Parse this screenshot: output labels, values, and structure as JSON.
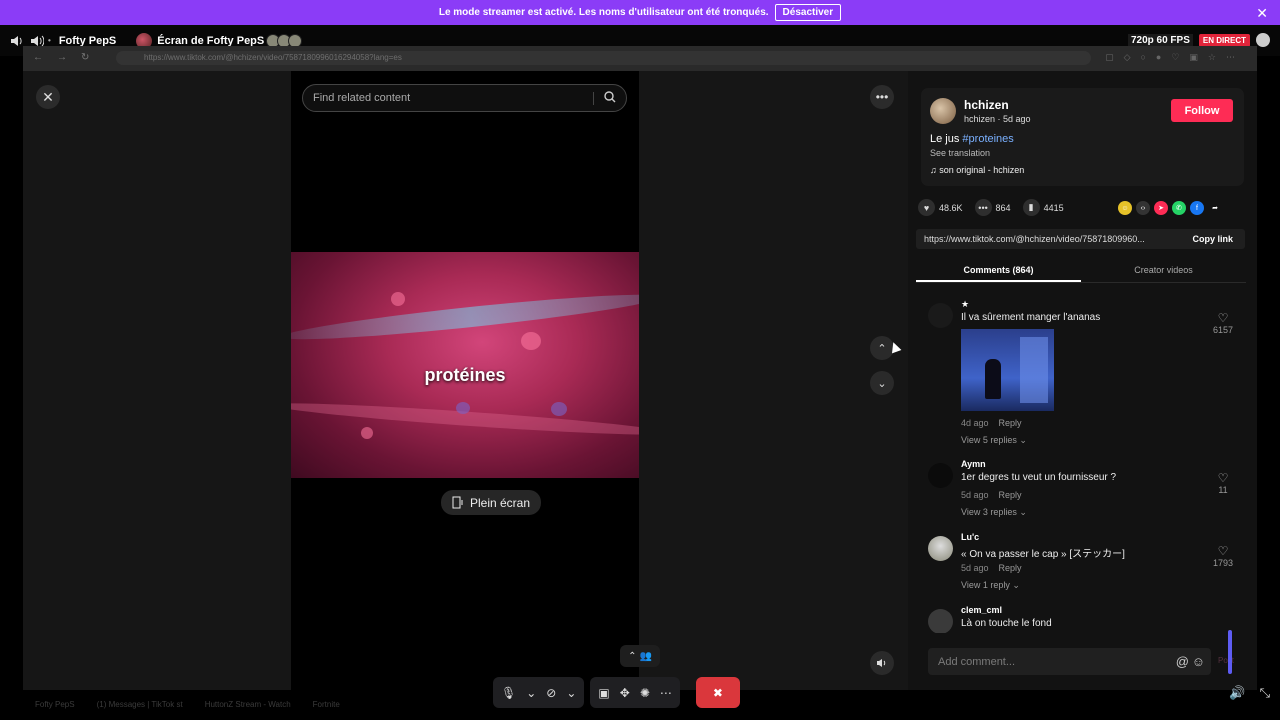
{
  "banner": {
    "text": "Le mode streamer est activé. Les noms d'utilisateur ont été tronqués.",
    "button": "Désactiver",
    "close": "✕"
  },
  "stream_header": {
    "user": "Fofty PepS",
    "screen_title": "Écran de Fofty PepS",
    "quality": "720p 60 FPS",
    "live": "EN DIRECT"
  },
  "browser": {
    "url": "https://www.tiktok.com/@hchizen/video/7587180996016294058?lang=es"
  },
  "tiktok": {
    "search_placeholder": "Find related content",
    "video_caption": "protéines",
    "fullscreen_label": "Plein écran",
    "author": {
      "name": "hchizen",
      "sub": "hchizen · 5d ago",
      "follow": "Follow",
      "desc_prefix": "Le jus ",
      "hashtag": "#proteines",
      "see_translation": "See translation",
      "sound": "son original - hchizen"
    },
    "stats": {
      "likes": "48.6K",
      "comments": "864",
      "saves": "4415"
    },
    "link": {
      "url": "https://www.tiktok.com/@hchizen/video/75871809960...",
      "copy": "Copy link"
    },
    "tabs": {
      "comments": "Comments (864)",
      "creator": "Creator videos"
    },
    "comments": [
      {
        "name": "★",
        "text": "Il va sûrement manger l'ananas",
        "date": "4d ago",
        "reply": "Reply",
        "replies": "View 5 replies",
        "likes": "6157"
      },
      {
        "name": "Aymn",
        "text": "1er degres tu veut un fournisseur ?",
        "date": "5d ago",
        "reply": "Reply",
        "replies": "View 3 replies",
        "likes": "11"
      },
      {
        "name": "Lu'c",
        "text": "« On va passer le cap » [ステッカー]",
        "date": "5d ago",
        "reply": "Reply",
        "replies": "View 1 reply",
        "likes": "1793"
      },
      {
        "name": "clem_cml",
        "text": "Là on touche le fond"
      }
    ],
    "add_comment": "Add comment...",
    "post": "Post"
  },
  "taskbar": {
    "items": [
      "Fofty PepS",
      "(1) Messages | TikTok st",
      "HuttonZ Stream - Watch",
      "Fortnite"
    ]
  },
  "colors": {
    "banner": "#8b3cf7",
    "follow": "#fe2c55",
    "hangup": "#da373c",
    "live": "#e2243a"
  }
}
